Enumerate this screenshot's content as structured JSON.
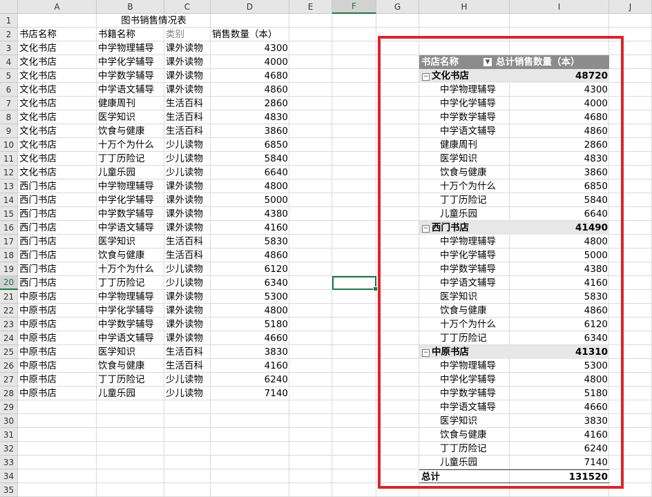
{
  "columns": [
    "A",
    "B",
    "C",
    "D",
    "E",
    "F",
    "G",
    "H",
    "I",
    "J"
  ],
  "selected_column": "F",
  "selected_row": 20,
  "rows": [
    1,
    2,
    3,
    4,
    5,
    6,
    7,
    8,
    9,
    10,
    11,
    12,
    13,
    14,
    15,
    16,
    17,
    18,
    19,
    20,
    21,
    22,
    23,
    24,
    25,
    26,
    27,
    28,
    29,
    30,
    31,
    32,
    33,
    34,
    35
  ],
  "sheet_title": "图书销售情况表",
  "headers": [
    "书店名称",
    "书籍名称",
    "类别",
    "销售数量（本）"
  ],
  "records": [
    [
      "文化书店",
      "中学物理辅导",
      "课外读物",
      "4300"
    ],
    [
      "文化书店",
      "中学化学辅导",
      "课外读物",
      "4000"
    ],
    [
      "文化书店",
      "中学数学辅导",
      "课外读物",
      "4680"
    ],
    [
      "文化书店",
      "中学语文辅导",
      "课外读物",
      "4860"
    ],
    [
      "文化书店",
      "健康周刊",
      "生活百科",
      "2860"
    ],
    [
      "文化书店",
      "医学知识",
      "生活百科",
      "4830"
    ],
    [
      "文化书店",
      "饮食与健康",
      "生活百科",
      "3860"
    ],
    [
      "文化书店",
      "十万个为什么",
      "少儿读物",
      "6850"
    ],
    [
      "文化书店",
      "丁丁历险记",
      "少儿读物",
      "5840"
    ],
    [
      "文化书店",
      "儿童乐园",
      "少儿读物",
      "6640"
    ],
    [
      "西门书店",
      "中学物理辅导",
      "课外读物",
      "4800"
    ],
    [
      "西门书店",
      "中学化学辅导",
      "课外读物",
      "5000"
    ],
    [
      "西门书店",
      "中学数学辅导",
      "课外读物",
      "4380"
    ],
    [
      "西门书店",
      "中学语文辅导",
      "课外读物",
      "4160"
    ],
    [
      "西门书店",
      "医学知识",
      "生活百科",
      "5830"
    ],
    [
      "西门书店",
      "饮食与健康",
      "生活百科",
      "4860"
    ],
    [
      "西门书店",
      "十万个为什么",
      "少儿读物",
      "6120"
    ],
    [
      "西门书店",
      "丁丁历险记",
      "少儿读物",
      "6340"
    ],
    [
      "中原书店",
      "中学物理辅导",
      "课外读物",
      "5300"
    ],
    [
      "中原书店",
      "中学化学辅导",
      "课外读物",
      "4800"
    ],
    [
      "中原书店",
      "中学数学辅导",
      "课外读物",
      "5180"
    ],
    [
      "中原书店",
      "中学语文辅导",
      "课外读物",
      "4660"
    ],
    [
      "中原书店",
      "医学知识",
      "生活百科",
      "3830"
    ],
    [
      "中原书店",
      "饮食与健康",
      "生活百科",
      "4160"
    ],
    [
      "中原书店",
      "丁丁历险记",
      "少儿读物",
      "6240"
    ],
    [
      "中原书店",
      "儿童乐园",
      "少儿读物",
      "7140"
    ]
  ],
  "pivot": {
    "header_row_label": "书店名称",
    "header_value_label": "总计销售数量（本）",
    "groups": [
      {
        "name": "文化书店",
        "total": "48720",
        "items": [
          [
            "中学物理辅导",
            "4300"
          ],
          [
            "中学化学辅导",
            "4000"
          ],
          [
            "中学数学辅导",
            "4680"
          ],
          [
            "中学语文辅导",
            "4860"
          ],
          [
            "健康周刊",
            "2860"
          ],
          [
            "医学知识",
            "4830"
          ],
          [
            "饮食与健康",
            "3860"
          ],
          [
            "十万个为什么",
            "6850"
          ],
          [
            "丁丁历险记",
            "5840"
          ],
          [
            "儿童乐园",
            "6640"
          ]
        ]
      },
      {
        "name": "西门书店",
        "total": "41490",
        "items": [
          [
            "中学物理辅导",
            "4800"
          ],
          [
            "中学化学辅导",
            "5000"
          ],
          [
            "中学数学辅导",
            "4380"
          ],
          [
            "中学语文辅导",
            "4160"
          ],
          [
            "医学知识",
            "5830"
          ],
          [
            "饮食与健康",
            "4860"
          ],
          [
            "十万个为什么",
            "6120"
          ],
          [
            "丁丁历险记",
            "6340"
          ]
        ]
      },
      {
        "name": "中原书店",
        "total": "41310",
        "items": [
          [
            "中学物理辅导",
            "5300"
          ],
          [
            "中学化学辅导",
            "4800"
          ],
          [
            "中学数学辅导",
            "5180"
          ],
          [
            "中学语文辅导",
            "4660"
          ],
          [
            "医学知识",
            "3830"
          ],
          [
            "饮食与健康",
            "4160"
          ],
          [
            "丁丁历险记",
            "6240"
          ],
          [
            "儿童乐园",
            "7140"
          ]
        ]
      }
    ],
    "grand_total_label": "总计",
    "grand_total": "131520"
  },
  "colors": {
    "highlight_border": "#d9262d",
    "selection": "#217346",
    "pivot_header": "#8c8c8c",
    "pivot_group": "#e7e7e7"
  }
}
